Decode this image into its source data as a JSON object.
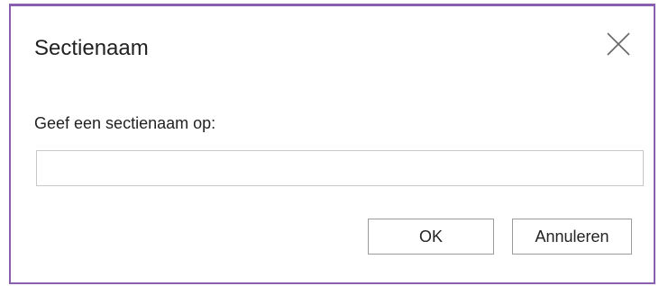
{
  "dialog": {
    "title": "Sectienaam",
    "close_icon": "close-icon",
    "prompt": "Geef een sectienaam op:",
    "input": {
      "value": "",
      "placeholder": ""
    },
    "buttons": {
      "ok_label": "OK",
      "cancel_label": "Annuleren"
    }
  },
  "colors": {
    "border_accent": "#8a5fb0",
    "input_border": "#c8c8c8",
    "button_border": "#9b9b9b",
    "text": "#222222"
  }
}
